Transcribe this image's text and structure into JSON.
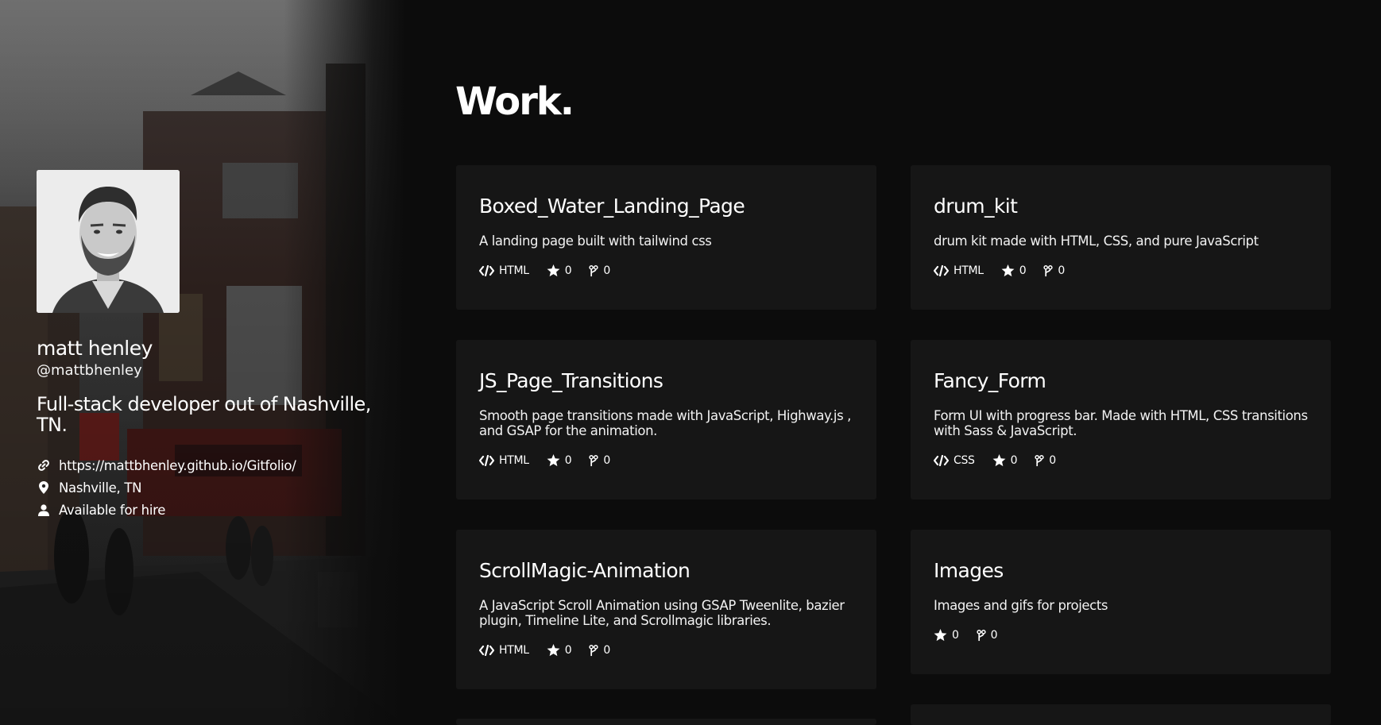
{
  "profile": {
    "name": "matt henley",
    "handle": "@mattbhenley",
    "bio": "Full-stack developer out of Nashville, TN.",
    "website": "https://mattbhenley.github.io/Gitfolio/",
    "location": "Nashville, TN",
    "hireable": "Available for hire",
    "icons": {
      "website": "link-icon",
      "location": "map-pin-icon",
      "hireable": "user-icon"
    }
  },
  "work": {
    "heading": "Work.",
    "projects": [
      {
        "name": "Boxed_Water_Landing_Page",
        "description": "A landing page built with tailwind css",
        "language": "HTML",
        "stars": "0",
        "forks": "0"
      },
      {
        "name": "drum_kit",
        "description": "drum kit made with HTML, CSS, and pure JavaScript",
        "language": "HTML",
        "stars": "0",
        "forks": "0"
      },
      {
        "name": "JS_Page_Transitions",
        "description": "Smooth page transitions made with JavaScript, Highway.js , and GSAP for the animation.",
        "language": "HTML",
        "stars": "0",
        "forks": "0"
      },
      {
        "name": "Fancy_Form",
        "description": "Form UI with progress bar. Made with HTML, CSS transitions with Sass & JavaScript.",
        "language": "CSS",
        "stars": "0",
        "forks": "0"
      },
      {
        "name": "ScrollMagic-Animation",
        "description": "A JavaScript Scroll Animation using GSAP Tweenlite, bazier plugin, Timeline Lite, and Scrollmagic libraries.",
        "language": "HTML",
        "stars": "0",
        "forks": "0"
      },
      {
        "name": "Images",
        "description": "Images and gifs for projects",
        "language": "",
        "stars": "0",
        "forks": "0"
      }
    ]
  },
  "colors": {
    "page_bg": "#0c0c0c",
    "card_bg": "#161616",
    "text": "#ffffff"
  }
}
